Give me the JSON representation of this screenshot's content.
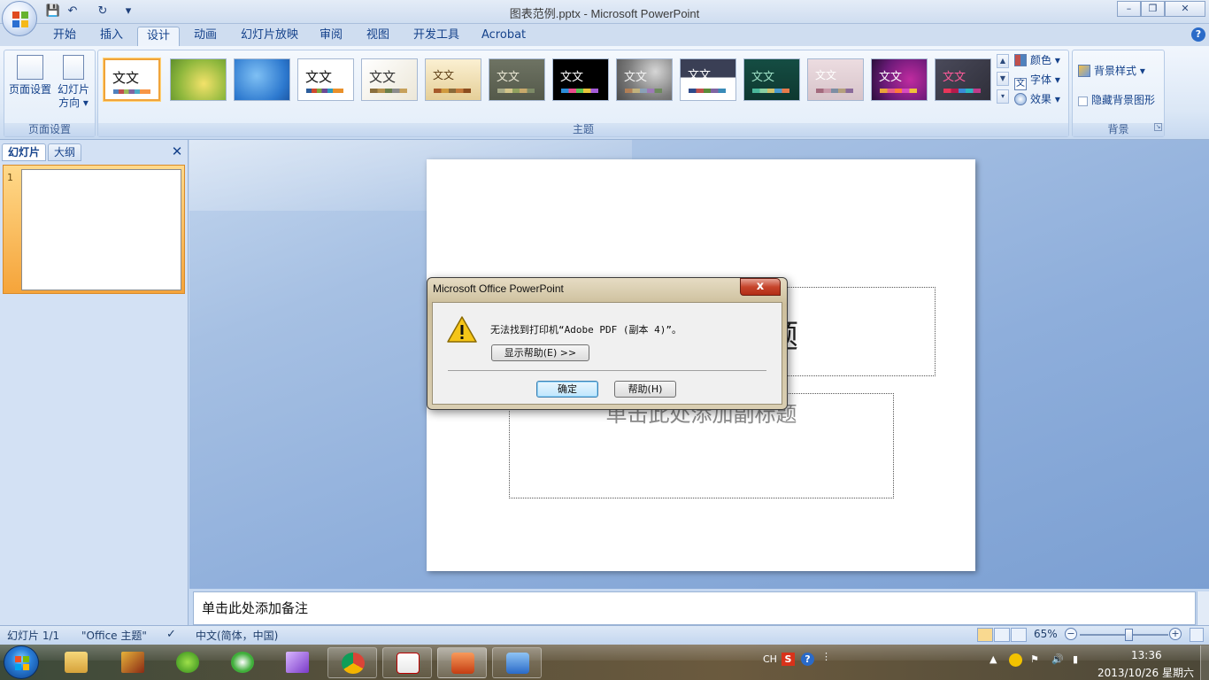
{
  "window": {
    "title": "图表范例.pptx - Microsoft PowerPoint",
    "minimize": "–",
    "maximize": "❐",
    "close": "✕"
  },
  "qat": {
    "save": "💾",
    "undo": "↶",
    "redo": "↻",
    "more": "▾"
  },
  "tabs": [
    "开始",
    "插入",
    "设计",
    "动画",
    "幻灯片放映",
    "审阅",
    "视图",
    "开发工具",
    "Acrobat"
  ],
  "active_tab": "设计",
  "ribbon": {
    "page_setup_group": {
      "label": "页面设置",
      "page_setup_btn": "页面设置",
      "orientation_btn_line1": "幻灯片",
      "orientation_btn_line2": "方向 ▾"
    },
    "themes_group": {
      "label": "主题",
      "theme_text": "文文",
      "colors": "颜色 ▾",
      "fonts": "字体 ▾",
      "effects": "效果 ▾"
    },
    "background_group": {
      "label": "背景",
      "bg_styles": "背景样式 ▾",
      "hide_bg": "隐藏背景图形"
    }
  },
  "left_pane": {
    "tab_slides": "幻灯片",
    "tab_outline": "大纲",
    "close": "✕",
    "slide_number": "1"
  },
  "slide": {
    "title_placeholder_visible": "标题",
    "subtitle_placeholder": "单击此处添加副标题"
  },
  "notes_placeholder": "单击此处添加备注",
  "status": {
    "slide_count": "幻灯片 1/1",
    "theme": "\"Office 主题\"",
    "language": "中文(简体，中国)",
    "zoom": "65%",
    "zoom_minus": "−",
    "zoom_plus": "+",
    "zoom_level": 0.55
  },
  "dialog": {
    "title": "Microsoft Office PowerPoint",
    "close": "x",
    "message": "无法找到打印机“Adobe PDF (副本 4)”。",
    "show_help": "显示帮助(E) >>",
    "ok": "确定",
    "help": "帮助(H)"
  },
  "taskbar": {
    "tray_ch": "CH",
    "tray_s": "S",
    "tray_help": "?",
    "time": "13:36",
    "date": "2013/10/26 星期六"
  },
  "colors": {
    "accent_orange": "#f0a43a",
    "ribbon_text": "#15428b"
  }
}
